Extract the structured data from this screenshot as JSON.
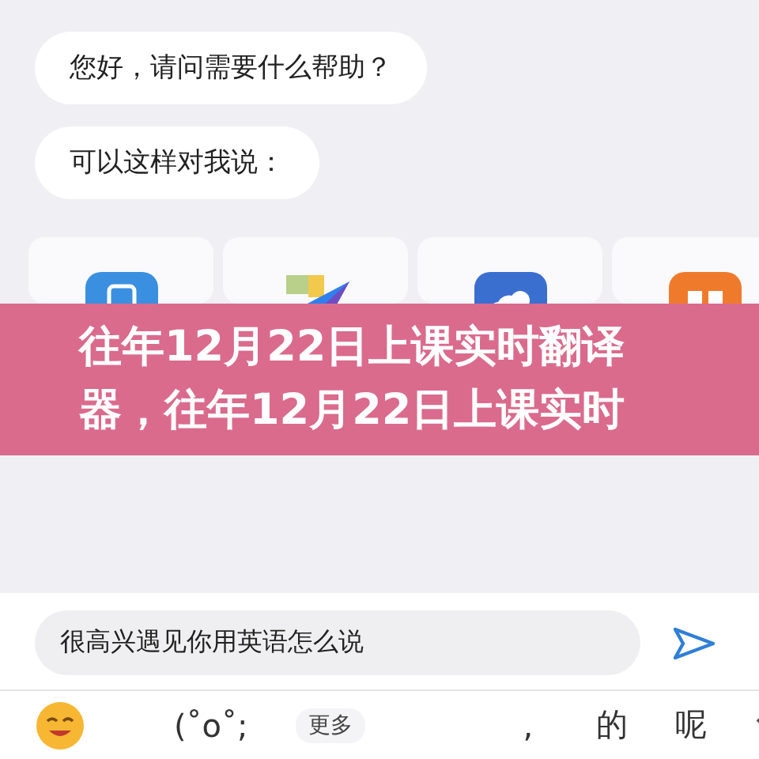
{
  "messages": [
    "您好，请问需要什么帮助？",
    "可以这样对我说："
  ],
  "banner": {
    "title": "往年12月22日上课实时翻译器，往年12月22日上课实时"
  },
  "input": {
    "value": "很高兴遇见你用英语怎么说"
  },
  "candidates": [
    {
      "kind": "text",
      "text": "(˚o˚;"
    },
    {
      "kind": "chip",
      "text": "更多"
    },
    {
      "kind": "text",
      "text": ","
    },
    {
      "kind": "text",
      "text": "的"
    },
    {
      "kind": "text",
      "text": "呢"
    }
  ]
}
